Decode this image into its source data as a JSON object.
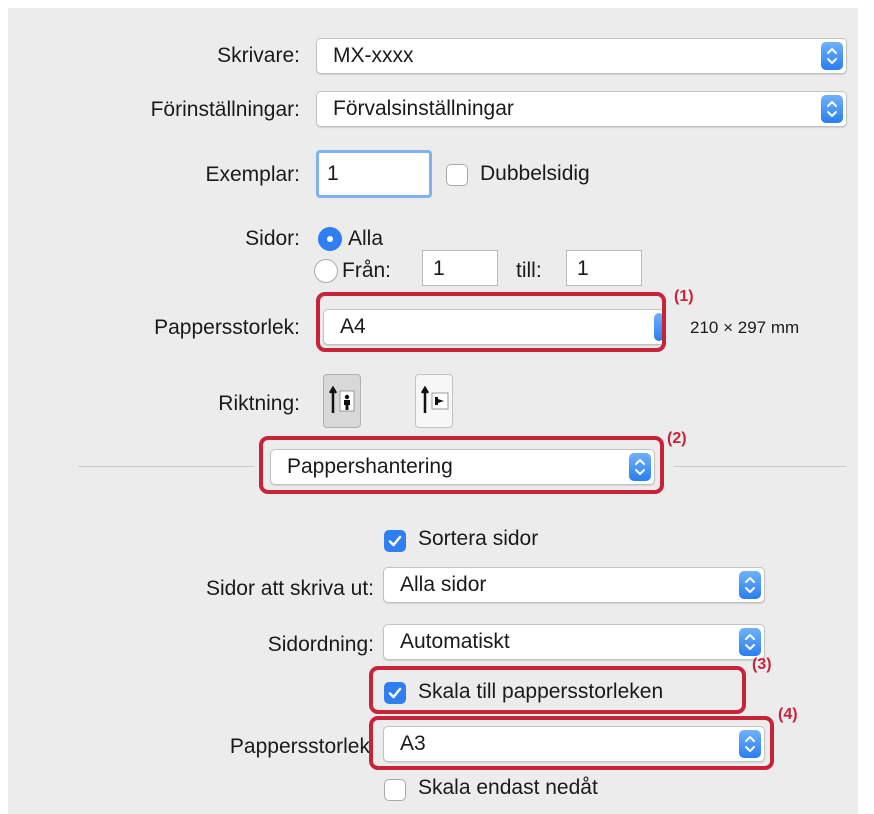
{
  "printer": {
    "label": "Skrivare:",
    "value": "MX-xxxx"
  },
  "presets": {
    "label": "Förinställningar:",
    "value": "Förvalsinställningar"
  },
  "copies": {
    "label": "Exemplar:",
    "value": "1",
    "duplex_label": "Dubbelsidig",
    "duplex_checked": false
  },
  "pages": {
    "label": "Sidor:",
    "all_label": "Alla",
    "from_label": "Från:",
    "from_value": "1",
    "to_label": "till:",
    "to_value": "1",
    "selected": "all"
  },
  "paper_size": {
    "label": "Pappersstorlek:",
    "value": "A4",
    "dimensions": "210 × 297 mm"
  },
  "orientation": {
    "label": "Riktning:",
    "selected": "portrait",
    "icons": [
      "portrait-orientation-icon",
      "landscape-orientation-icon"
    ]
  },
  "section_popup": {
    "value": "Pappershantering"
  },
  "paper_handling": {
    "collate_label": "Sortera sidor",
    "collate_checked": true,
    "pages_to_print_label": "Sidor att skriva ut:",
    "pages_to_print_value": "Alla sidor",
    "page_order_label": "Sidordning:",
    "page_order_value": "Automatiskt",
    "scale_label": "Skala till pappersstorleken",
    "scale_checked": true,
    "dest_size_label": "Pappersstorlek",
    "dest_size_value": "A3",
    "scale_down_label": "Skala endast nedåt",
    "scale_down_checked": false
  },
  "annotations": [
    "(1)",
    "(2)",
    "(3)",
    "(4)"
  ],
  "colors": {
    "highlight": "#c7243a",
    "accent": "#2e7ff1",
    "panel": "#ececec"
  }
}
